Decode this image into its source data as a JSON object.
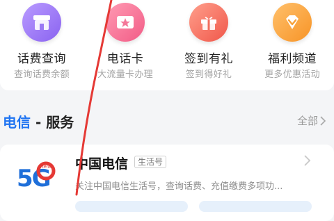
{
  "quick_actions": [
    {
      "label": "话费查询",
      "sub": "查询话费余额",
      "icon": "shop-icon"
    },
    {
      "label": "电话卡",
      "sub": "大流量卡办理",
      "icon": "card-star-icon"
    },
    {
      "label": "签到有礼",
      "sub": "签到得好礼",
      "icon": "gift-icon"
    },
    {
      "label": "福利频道",
      "sub": "更多优惠活动",
      "icon": "diamond-icon"
    }
  ],
  "section": {
    "title_part1": "电信",
    "title_part2": " - 服务",
    "all_label": "全部"
  },
  "service": {
    "name": "中国电信",
    "tag": "生活号",
    "description": "关注中国电信生活号，查询话费、充值缴费多项功...",
    "logo_text": "5G",
    "logo_small_text": "hello"
  },
  "colors": {
    "accent_blue": "#1f74f2",
    "annotation_red": "#e53935"
  }
}
